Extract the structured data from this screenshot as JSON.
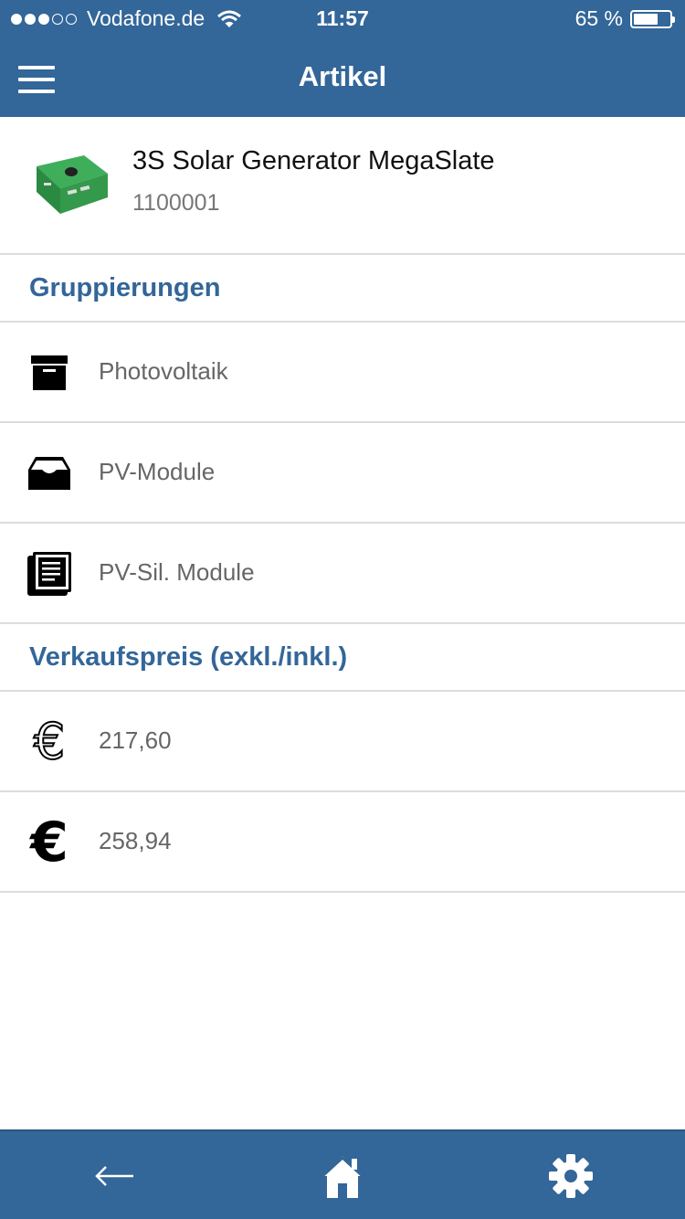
{
  "status_bar": {
    "carrier": "Vodafone.de",
    "time": "11:57",
    "battery": "65 %",
    "battery_level": 0.65
  },
  "nav": {
    "title": "Artikel"
  },
  "article": {
    "name": "3S Solar Generator MegaSlate",
    "number": "1100001"
  },
  "groupings": {
    "header": "Gruppierungen",
    "items": [
      {
        "label": "Photovoltaik",
        "icon": "archive-box-icon"
      },
      {
        "label": "PV-Module",
        "icon": "inbox-tray-icon"
      },
      {
        "label": "PV-Sil. Module",
        "icon": "document-list-icon"
      }
    ]
  },
  "prices": {
    "header": "Verkaufspreis (exkl./inkl.)",
    "items": [
      {
        "value": "217,60",
        "icon": "euro-outline-icon"
      },
      {
        "value": "258,94",
        "icon": "euro-bold-icon"
      }
    ]
  },
  "tabbar": {
    "items": [
      "back-arrow-icon",
      "home-icon",
      "gear-icon"
    ]
  },
  "colors": {
    "brand": "#336699",
    "divider": "#dcdcdc",
    "muted_text": "#666666"
  }
}
